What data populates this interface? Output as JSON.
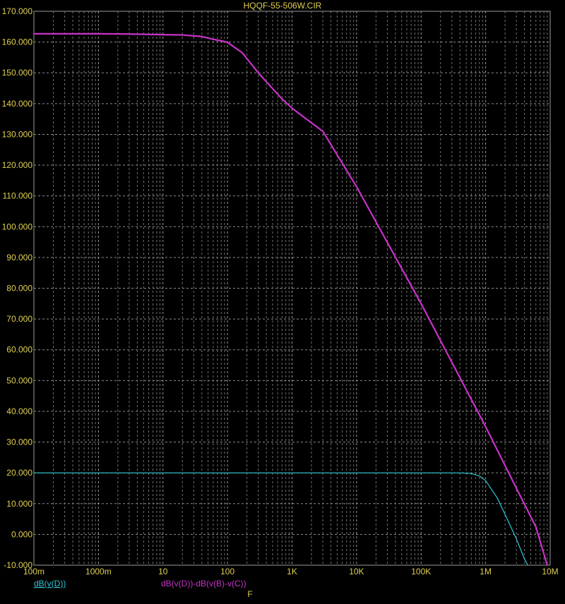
{
  "chart_data": {
    "type": "line",
    "title": "HQQF-55-506W.CIR",
    "xlabel": "F",
    "ylabel": "",
    "xscale": "log",
    "xlim": [
      0.1,
      10000000
    ],
    "ylim": [
      -10,
      170
    ],
    "grid": true,
    "x_ticks": [
      {
        "value": 0.1,
        "label": "100m"
      },
      {
        "value": 1,
        "label": "1000m"
      },
      {
        "value": 10,
        "label": "10"
      },
      {
        "value": 100,
        "label": "100"
      },
      {
        "value": 1000,
        "label": "1K"
      },
      {
        "value": 10000,
        "label": "10K"
      },
      {
        "value": 100000,
        "label": "100K"
      },
      {
        "value": 1000000,
        "label": "1M"
      },
      {
        "value": 10000000,
        "label": "10M"
      }
    ],
    "y_ticks": [
      {
        "value": 170,
        "label": "170.000"
      },
      {
        "value": 160,
        "label": "160.000"
      },
      {
        "value": 150,
        "label": "150.000"
      },
      {
        "value": 140,
        "label": "140.000"
      },
      {
        "value": 130,
        "label": "130.000"
      },
      {
        "value": 120,
        "label": "120.000"
      },
      {
        "value": 110,
        "label": "110.000"
      },
      {
        "value": 100,
        "label": "100.000"
      },
      {
        "value": 90,
        "label": "90.000"
      },
      {
        "value": 80,
        "label": "80.000"
      },
      {
        "value": 70,
        "label": "70.000"
      },
      {
        "value": 60,
        "label": "60.000"
      },
      {
        "value": 50,
        "label": "50.000"
      },
      {
        "value": 40,
        "label": "40.000"
      },
      {
        "value": 30,
        "label": "30.000"
      },
      {
        "value": 20,
        "label": "20.000"
      },
      {
        "value": 10,
        "label": "10.000"
      },
      {
        "value": 0,
        "label": "0.000"
      },
      {
        "value": -10,
        "label": "-10.000"
      }
    ],
    "series": [
      {
        "name": "dB(v(D))",
        "color": "#2ec8d8",
        "x": [
          0.1,
          1,
          10,
          100,
          1000,
          10000,
          100000,
          400000,
          600000,
          800000,
          1000000,
          1500000,
          2000000,
          3000000,
          4000000,
          4500000
        ],
        "y": [
          20,
          20,
          20,
          20,
          20,
          20,
          20,
          20,
          19.8,
          19,
          17.5,
          12,
          6.5,
          -1.5,
          -8,
          -10
        ]
      },
      {
        "name": "dB(v(D))-dB(v(B)-v(C))",
        "color": "#c832c8",
        "x": [
          0.1,
          1,
          3,
          10,
          20,
          40,
          60,
          80,
          100,
          170,
          300,
          700,
          1000,
          3000,
          10000,
          100000,
          1000000,
          3000000,
          6000000,
          9000000
        ],
        "y": [
          162.7,
          162.7,
          162.6,
          162.4,
          162.3,
          161.8,
          160.9,
          160.4,
          159.9,
          156.5,
          150,
          141.5,
          138.5,
          131,
          113,
          75,
          35,
          15,
          2.5,
          -10
        ]
      }
    ]
  }
}
